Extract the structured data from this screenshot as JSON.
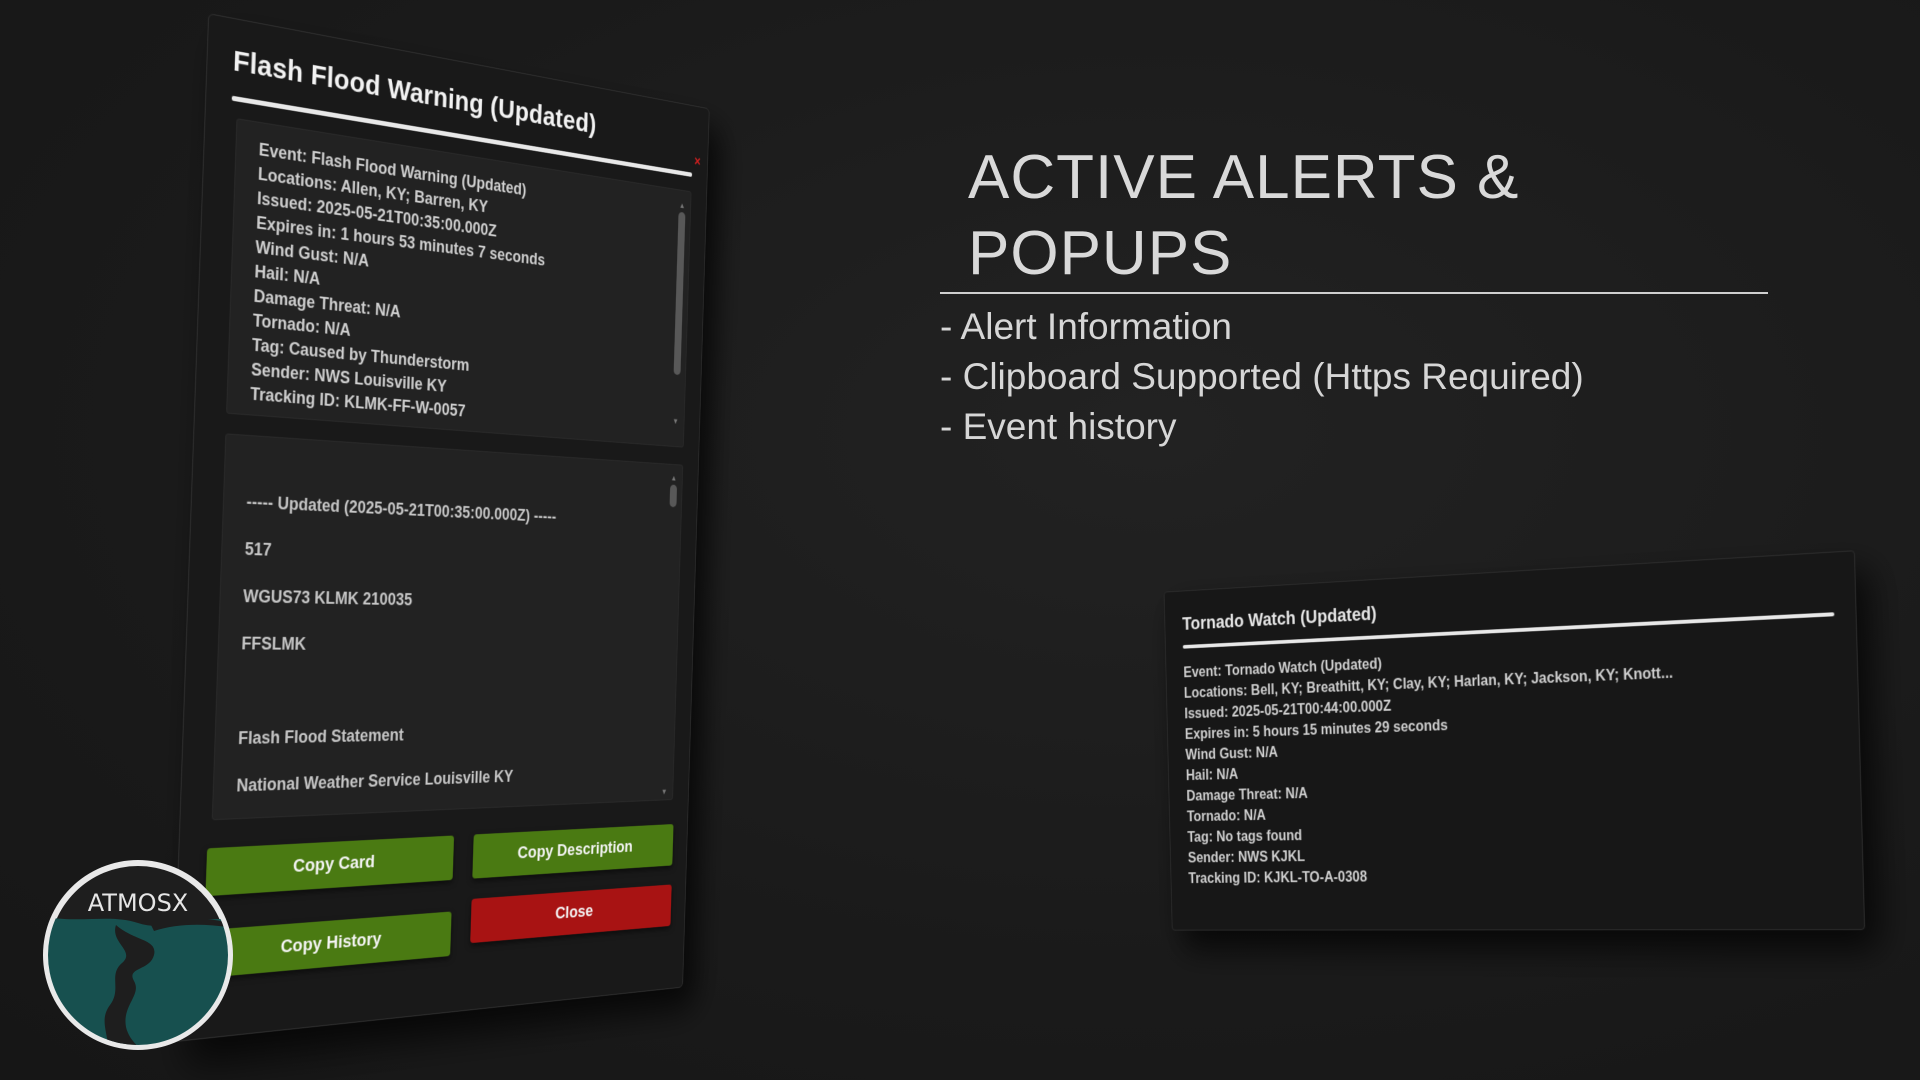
{
  "popup": {
    "title": "Flash Flood Warning (Updated)",
    "close_x": "×",
    "info_lines": [
      "Event: Flash Flood Warning (Updated)",
      "Locations: Allen, KY; Barren, KY",
      "Issued: 2025-05-21T00:35:00.000Z",
      "Expires in: 1 hours 53 minutes 7 seconds",
      "Wind Gust: N/A",
      "Hail: N/A",
      "Damage Threat: N/A",
      "Tornado: N/A",
      "Tag: Caused by Thunderstorm",
      "Sender: NWS Louisville KY",
      "Tracking ID: KLMK-FF-W-0057"
    ],
    "history_lines": [
      "----- Updated (2025-05-21T00:35:00.000Z) -----",
      "",
      "517",
      "",
      "WGUS73 KLMK 210035",
      "",
      "FFSLMK",
      "",
      "",
      "",
      "Flash Flood Statement",
      "",
      "National Weather Service Louisville KY"
    ],
    "buttons": {
      "copy_card": "Copy Card",
      "copy_description": "Copy Description",
      "copy_history": "Copy History",
      "close": "Close"
    }
  },
  "heading": {
    "title": "ACTIVE ALERTS & POPUPS",
    "features": [
      "- Alert Information",
      "- Clipboard Supported (Https Required)",
      "- Event history"
    ]
  },
  "card": {
    "title": "Tornado Watch (Updated)",
    "lines": [
      "Event: Tornado Watch (Updated)",
      "Locations: Bell, KY; Breathitt, KY; Clay, KY; Harlan, KY; Jackson, KY; Knott...",
      "Issued: 2025-05-21T00:44:00.000Z",
      "Expires in: 5 hours 15 minutes 29 seconds",
      "Wind Gust: N/A",
      "Hail: N/A",
      "Damage Threat: N/A",
      "Tornado: N/A",
      "Tag: No tags found",
      "Sender: NWS KJKL",
      "Tracking ID: KJKL-TO-A-0308"
    ]
  },
  "logo": {
    "text": "ATMOSX"
  },
  "colors": {
    "button_green": "#4a7a12",
    "button_red": "#a81313",
    "close_x": "#d21f1f",
    "logo_teal": "#17504f"
  }
}
